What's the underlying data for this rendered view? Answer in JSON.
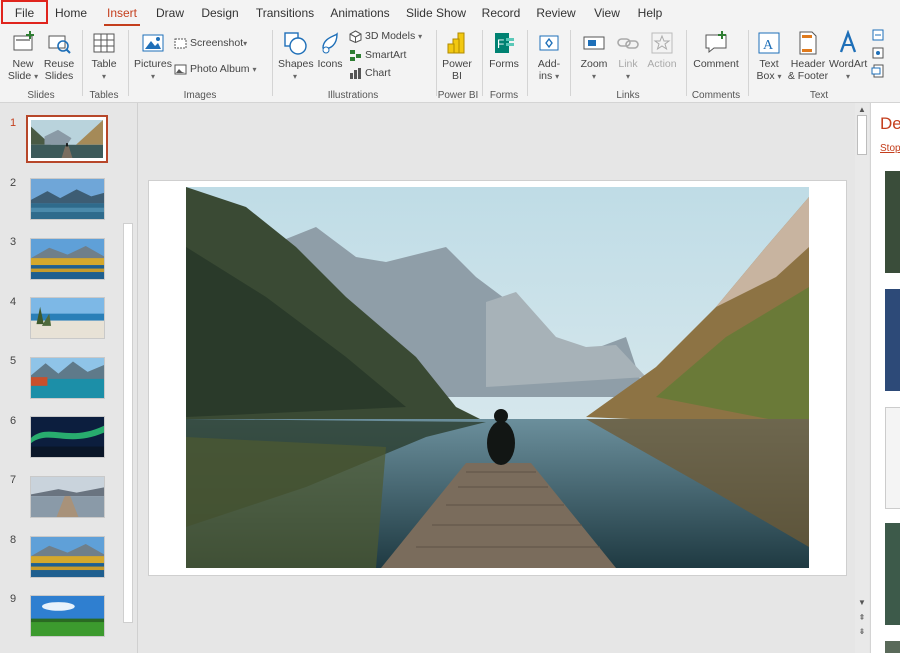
{
  "tabs": [
    {
      "key": "file",
      "label": "File"
    },
    {
      "key": "home",
      "label": "Home"
    },
    {
      "key": "insert",
      "label": "Insert",
      "active": true
    },
    {
      "key": "draw",
      "label": "Draw"
    },
    {
      "key": "design",
      "label": "Design"
    },
    {
      "key": "transitions",
      "label": "Transitions"
    },
    {
      "key": "animations",
      "label": "Animations"
    },
    {
      "key": "slideshow",
      "label": "Slide Show"
    },
    {
      "key": "record",
      "label": "Record"
    },
    {
      "key": "review",
      "label": "Review"
    },
    {
      "key": "view",
      "label": "View"
    },
    {
      "key": "help",
      "label": "Help"
    }
  ],
  "ribbon": {
    "slides": {
      "group_label": "Slides",
      "new_slide_1": "New",
      "new_slide_2": "Slide",
      "reuse_1": "Reuse",
      "reuse_2": "Slides"
    },
    "tables": {
      "group_label": "Tables",
      "table": "Table"
    },
    "images": {
      "group_label": "Images",
      "pictures": "Pictures",
      "screenshot": "Screenshot",
      "photo_album": "Photo Album"
    },
    "illustrations": {
      "group_label": "Illustrations",
      "shapes": "Shapes",
      "icons": "Icons",
      "models3d": "3D Models",
      "smartart": "SmartArt",
      "chart": "Chart"
    },
    "powerbi": {
      "group_label": "Power BI",
      "label_1": "Power",
      "label_2": "BI"
    },
    "forms": {
      "group_label": "Forms",
      "label": "Forms"
    },
    "addins": {
      "label_1": "Add-",
      "label_2": "ins"
    },
    "links": {
      "group_label": "Links",
      "zoom": "Zoom",
      "link": "Link",
      "action": "Action"
    },
    "comments": {
      "group_label": "Comments",
      "comment": "Comment"
    },
    "text": {
      "group_label": "Text",
      "textbox_1": "Text",
      "textbox_2": "Box",
      "header_1": "Header",
      "header_2": "& Footer",
      "wordart": "WordArt"
    }
  },
  "slides": [
    {
      "num": "1",
      "active": true,
      "scene": "lake-pier"
    },
    {
      "num": "2",
      "scene": "blue-lake"
    },
    {
      "num": "3",
      "scene": "autumn-lake"
    },
    {
      "num": "4",
      "scene": "beach"
    },
    {
      "num": "5",
      "scene": "turquoise-lake"
    },
    {
      "num": "6",
      "scene": "aurora"
    },
    {
      "num": "7",
      "scene": "pier"
    },
    {
      "num": "8",
      "scene": "autumn-lake"
    },
    {
      "num": "9",
      "scene": "green-field"
    }
  ],
  "designer": {
    "title": "De",
    "stop": "Stop"
  },
  "colors": {
    "accent": "#c43e1c",
    "highlight_box": "#e0241c"
  }
}
